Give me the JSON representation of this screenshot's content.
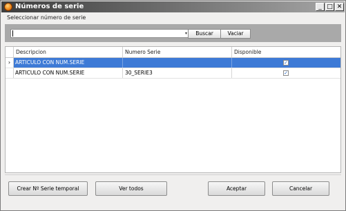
{
  "window": {
    "title": "Números de serie",
    "controls": {
      "minimize": "_",
      "maximize": "□",
      "close": "✕"
    }
  },
  "subtitle": "Seleccionar número de serie",
  "toolbar": {
    "combo_value": "",
    "combo_arrow": "▾",
    "search_label": "Buscar",
    "clear_label": "Vaciar"
  },
  "grid": {
    "columns": [
      "Descripcion",
      "Numero Serie",
      "Disponible"
    ],
    "rows": [
      {
        "indicator": "›",
        "descripcion": "ARTICULO CON NUM.SERIE",
        "numero_serie": "",
        "disponible": "✓",
        "selected": true
      },
      {
        "indicator": "",
        "descripcion": "ARTICULO CON NUM.SERIE",
        "numero_serie": "30_SERIE3",
        "disponible": "✓",
        "selected": false
      }
    ]
  },
  "footer": {
    "temporal_label": "Crear Nº Serie temporal",
    "ver_todos_label": "Ver todos",
    "aceptar_label": "Aceptar",
    "cancelar_label": "Cancelar"
  },
  "colors": {
    "selection": "#3d7ad6",
    "toolbar_bg": "#a9a9a9",
    "window_bg": "#f0efee"
  }
}
